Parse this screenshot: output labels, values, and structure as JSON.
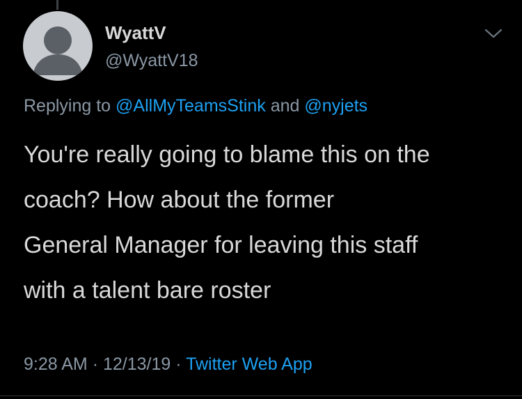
{
  "tweet": {
    "author": {
      "display_name": "WyattV",
      "handle": "@WyattV18"
    },
    "replying": {
      "prefix": "Replying to",
      "mentions": [
        "@AllMyTeamsStink",
        "@nyjets"
      ],
      "conjunction": "and"
    },
    "text_lines": [
      "You're really going to blame this on the",
      "coach?  How about the former",
      "General Manager for leaving this staff",
      "with a talent bare roster"
    ],
    "time": "9:28 AM",
    "date": "12/13/19",
    "separator": "·",
    "source": "Twitter Web App"
  },
  "icons": {
    "avatar": "default-avatar-icon",
    "menu": "chevron-down-icon"
  },
  "colors": {
    "background": "#000000",
    "primary_text": "#d9d9d9",
    "secondary_text": "#8b98a5",
    "link": "#1da1f2",
    "avatar_bg": "#c8ccd0",
    "avatar_fg": "#5b6067"
  }
}
